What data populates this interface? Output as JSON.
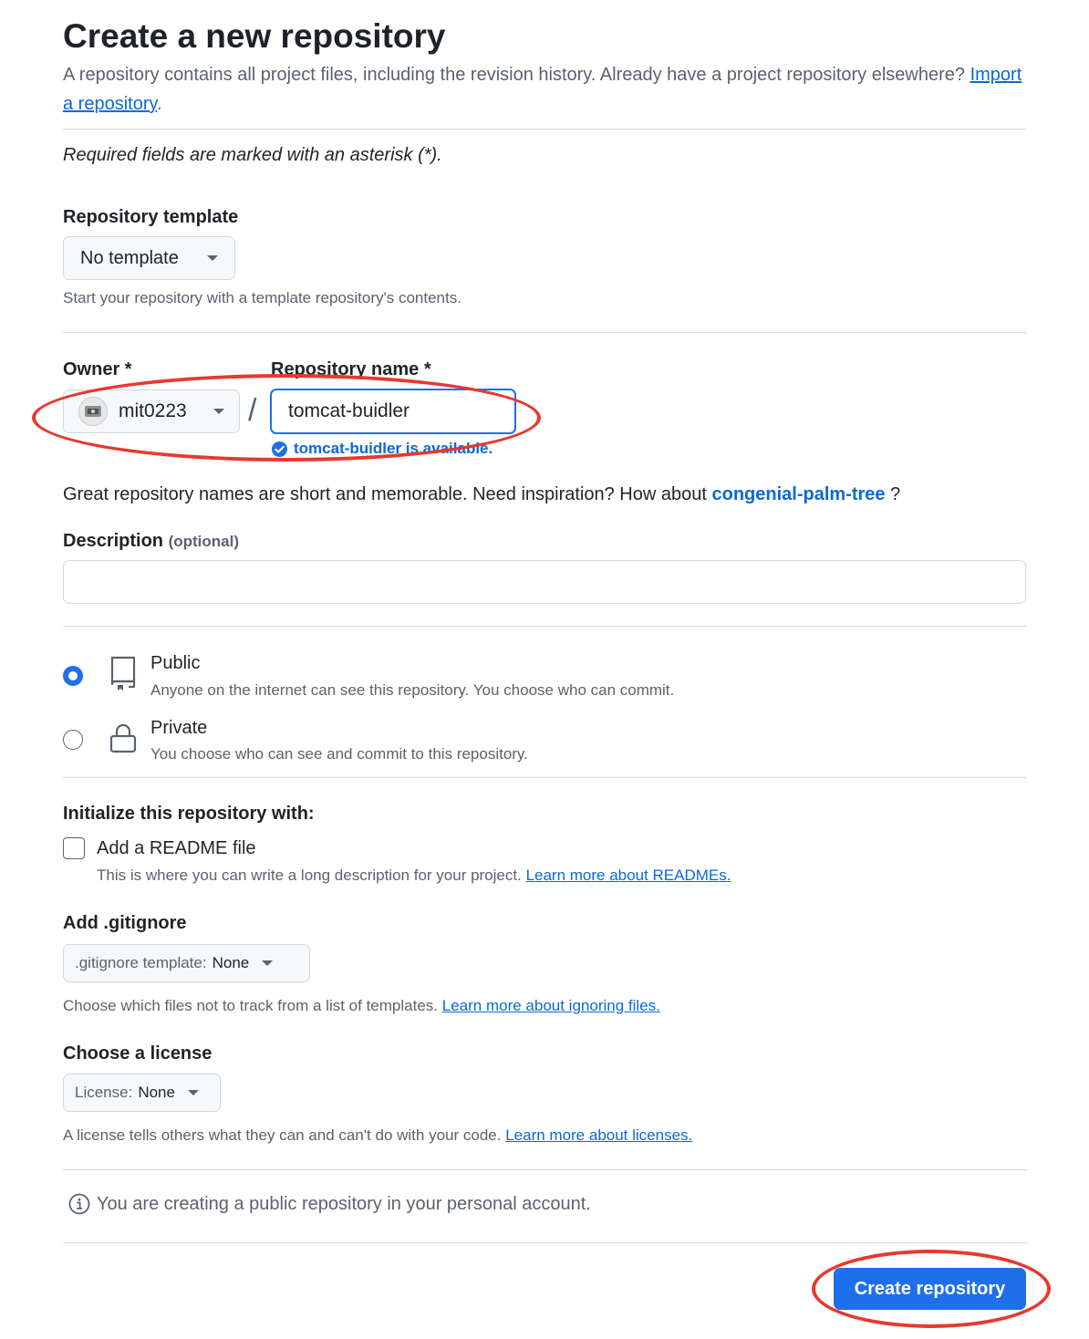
{
  "header": {
    "title": "Create a new repository",
    "description": "A repository contains all project files, including the revision history. Already have a project repository elsewhere?",
    "import_link": "Import a repository",
    "import_suffix": "."
  },
  "required_note": "Required fields are marked with an asterisk (*).",
  "template": {
    "label": "Repository template",
    "selected": "No template",
    "help": "Start your repository with a template repository's contents."
  },
  "owner": {
    "label": "Owner *",
    "value": "mit0223"
  },
  "separator": "/",
  "repo_name": {
    "label": "Repository name *",
    "value": "tomcat-buidler",
    "availability": "tomcat-buidler is available."
  },
  "suggestion": {
    "prefix": "Great repository names are short and memorable. Need inspiration? How about",
    "name": "congenial-palm-tree",
    "suffix": "?"
  },
  "description": {
    "label": "Description",
    "optional": "(optional)",
    "value": ""
  },
  "visibility": {
    "selected": "public",
    "options": [
      {
        "title": "Public",
        "desc": "Anyone on the internet can see this repository. You choose who can commit."
      },
      {
        "title": "Private",
        "desc": "You choose who can see and commit to this repository."
      }
    ]
  },
  "initialize": {
    "label": "Initialize this repository with:",
    "readme_label": "Add a README file",
    "readme_checked": false,
    "readme_help": "This is where you can write a long description for your project.",
    "readme_link": "Learn more about READMEs."
  },
  "gitignore": {
    "label": "Add .gitignore",
    "button_prefix": ".gitignore template:",
    "button_value": "None",
    "help": "Choose which files not to track from a list of templates.",
    "link": "Learn more about ignoring files."
  },
  "license": {
    "label": "Choose a license",
    "button_prefix": "License:",
    "button_value": "None",
    "help": "A license tells others what they can and can't do with your code.",
    "link": "Learn more about licenses."
  },
  "info_note": "You are creating a public repository in your personal account.",
  "submit_label": "Create repository",
  "colors": {
    "accent": "#1f6feb",
    "primary_button": "#1f6feb",
    "annotation": "#e53a2e"
  }
}
